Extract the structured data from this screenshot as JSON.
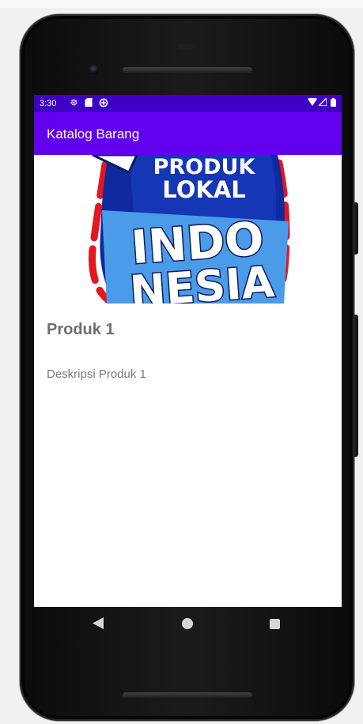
{
  "status_bar": {
    "time": "3:30",
    "left_icons": [
      "gear-icon",
      "sd-card-icon",
      "data-saver-icon"
    ],
    "right_icons": [
      "wifi-icon",
      "signal-icon",
      "battery-icon"
    ]
  },
  "app_bar": {
    "title": "Katalog Barang"
  },
  "product": {
    "image_text": {
      "line1": "PRODUK",
      "line2": "LOKAL",
      "line3": "INDO",
      "line4": "NESIA"
    },
    "name": "Produk 1",
    "description": "Deskripsi Produk 1"
  },
  "nav_bar": {
    "buttons": [
      "back-icon",
      "home-icon",
      "recents-icon"
    ]
  },
  "colors": {
    "status_bar": "#3d00c4",
    "app_bar": "#6200ee",
    "text_primary": "#6f6f6f",
    "text_secondary": "#7a7a7a"
  }
}
